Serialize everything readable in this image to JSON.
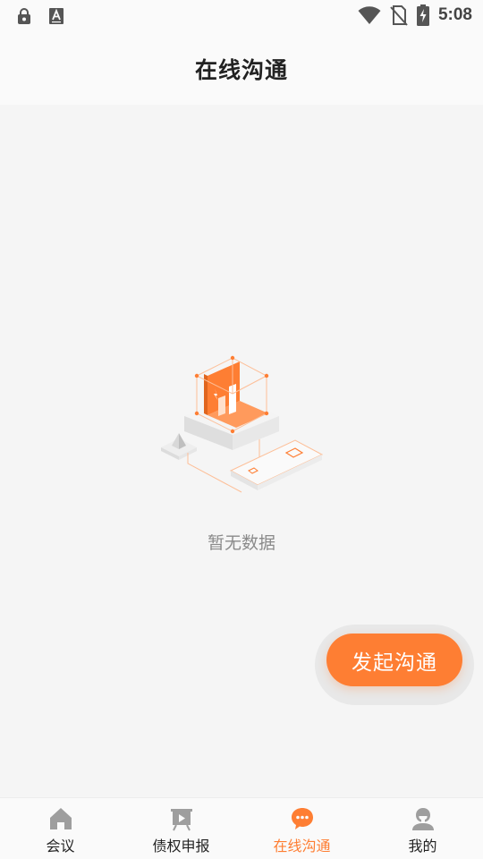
{
  "status_bar": {
    "time": "5:08",
    "icons": [
      "lock-notification-icon",
      "font-a-notification-icon",
      "wifi-icon",
      "no-sim-icon",
      "battery-charging-icon"
    ]
  },
  "header": {
    "title": "在线沟通"
  },
  "empty_state": {
    "illustration": "empty-data-illustration",
    "message": "暂无数据"
  },
  "fab": {
    "label": "发起沟通"
  },
  "bottom_nav": {
    "items": [
      {
        "label": "会议",
        "icon": "home-icon",
        "active": false
      },
      {
        "label": "债权申报",
        "icon": "presentation-icon",
        "active": false
      },
      {
        "label": "在线沟通",
        "icon": "chat-bubble-icon",
        "active": true
      },
      {
        "label": "我的",
        "icon": "person-icon",
        "active": false
      }
    ]
  },
  "colors": {
    "accent": "#fe7e33",
    "background": "#f5f5f5",
    "bar_background": "#fafafa",
    "inactive_icon": "#9e9e9e",
    "muted_text": "#8a8a8a"
  }
}
